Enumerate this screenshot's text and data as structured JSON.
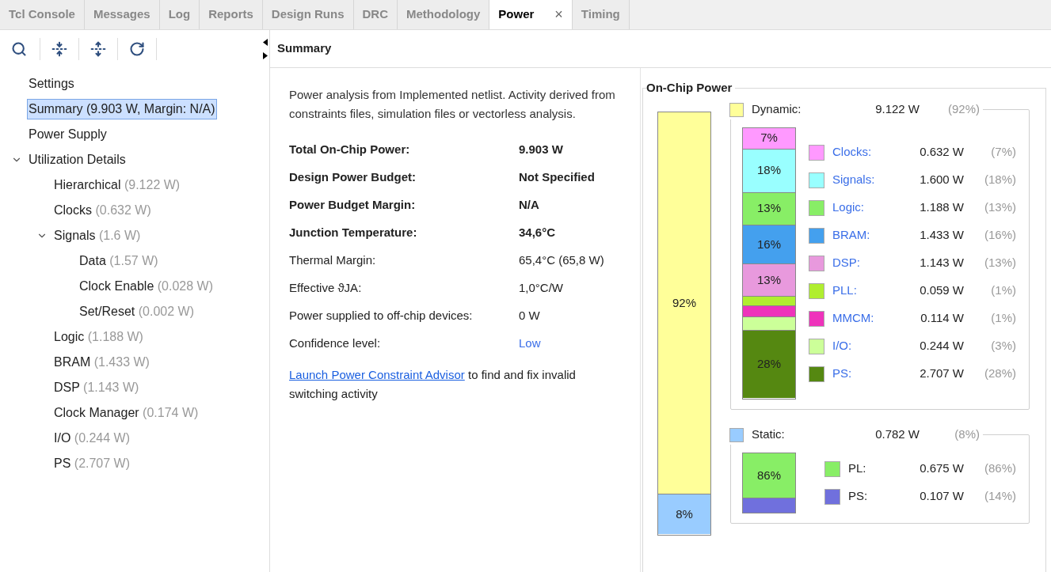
{
  "tabs": [
    {
      "label": "Tcl Console",
      "selected": false
    },
    {
      "label": "Messages",
      "selected": false
    },
    {
      "label": "Log",
      "selected": false
    },
    {
      "label": "Reports",
      "selected": false
    },
    {
      "label": "Design Runs",
      "selected": false
    },
    {
      "label": "DRC",
      "selected": false
    },
    {
      "label": "Methodology",
      "selected": false
    },
    {
      "label": "Power",
      "selected": true,
      "close": "×"
    },
    {
      "label": "Timing",
      "selected": false
    }
  ],
  "sidebar": {
    "tree": [
      {
        "label": "Settings",
        "selected": false
      },
      {
        "label": "Summary (9.903 W, Margin: N/A)",
        "selected": true
      },
      {
        "label": "Power Supply",
        "selected": false
      },
      {
        "label": "Utilization Details",
        "selected": false,
        "expanded": true,
        "children": [
          {
            "label": "Hierarchical",
            "detail": "(9.122 W)",
            "selected": false
          },
          {
            "label": "Clocks",
            "detail": "(0.632 W)",
            "selected": false
          },
          {
            "label": "Signals",
            "detail": "(1.6 W)",
            "selected": false,
            "expanded": true,
            "children": [
              {
                "label": "Data",
                "detail": "(1.57 W)",
                "selected": false
              },
              {
                "label": "Clock Enable",
                "detail": "(0.028 W)",
                "selected": false
              },
              {
                "label": "Set/Reset",
                "detail": "(0.002 W)",
                "selected": false
              }
            ]
          },
          {
            "label": "Logic",
            "detail": "(1.188 W)",
            "selected": false
          },
          {
            "label": "BRAM",
            "detail": "(1.433 W)",
            "selected": false
          },
          {
            "label": "DSP",
            "detail": "(1.143 W)",
            "selected": false
          },
          {
            "label": "Clock Manager",
            "detail": "(0.174 W)",
            "selected": false
          },
          {
            "label": "I/O",
            "detail": "(0.244 W)",
            "selected": false
          },
          {
            "label": "PS",
            "detail": "(2.707 W)",
            "selected": false
          }
        ]
      }
    ]
  },
  "panel_title": "Summary",
  "summary": {
    "description": "Power analysis from Implemented netlist. Activity derived from constraints files, simulation files or vectorless analysis.",
    "rows": [
      {
        "label": "Total On-Chip Power:",
        "value": "9.903 W",
        "bold": true,
        "link": false
      },
      {
        "label": "Design Power Budget:",
        "value": "Not Specified",
        "bold": true,
        "link": false
      },
      {
        "label": "Power Budget Margin:",
        "value": "N/A",
        "bold": true,
        "link": false
      },
      {
        "label": "Junction Temperature:",
        "value": "34,6°C",
        "bold": true,
        "link": false
      },
      {
        "label": "Thermal Margin:",
        "value": "65,4°C (65,8 W)",
        "bold": false,
        "link": false
      },
      {
        "label": "Effective ϑJA:",
        "value": "1,0°C/W",
        "bold": false,
        "link": false
      },
      {
        "label": "Power supplied to off-chip devices:",
        "value": "0 W",
        "bold": false,
        "link": false
      },
      {
        "label": "Confidence level:",
        "value": "Low",
        "bold": false,
        "link": true
      }
    ],
    "advisor": {
      "link": "Launch Power Constraint Advisor",
      "text": "to find and fix invalid switching activity"
    }
  },
  "on_chip_power": {
    "title": "On-Chip Power",
    "total_bar": [
      {
        "label": "92%",
        "level": 0.906,
        "color": "#ffff99"
      },
      {
        "label": "8%",
        "level": 0.094,
        "color": "#99ccff"
      }
    ],
    "groups": [
      {
        "name": "Dynamic:",
        "value": "9.122 W",
        "percent": "(92%)",
        "color": "#ffff99",
        "items": [
          {
            "name": "Clocks:",
            "value": "0.632 W",
            "percent": "(7%)",
            "color": "#ff99ff",
            "bar_label": "7%",
            "link": true
          },
          {
            "name": "Signals:",
            "value": "1.600 W",
            "percent": "(18%)",
            "color": "#99ffff",
            "bar_label": "18%",
            "link": true
          },
          {
            "name": "Logic:",
            "value": "1.188 W",
            "percent": "(13%)",
            "color": "#88ee66",
            "bar_label": "13%",
            "link": true
          },
          {
            "name": "BRAM:",
            "value": "1.433 W",
            "percent": "(16%)",
            "color": "#44a0ee",
            "bar_label": "16%",
            "link": true
          },
          {
            "name": "DSP:",
            "value": "1.143 W",
            "percent": "(13%)",
            "color": "#e899dd",
            "bar_label": "13%",
            "link": true
          },
          {
            "name": "PLL:",
            "value": "0.059 W",
            "percent": "(1%)",
            "color": "#b0ee30",
            "link": true
          },
          {
            "name": "MMCM:",
            "value": "0.114 W",
            "percent": "(1%)",
            "color": "#ee33bb",
            "link": true
          },
          {
            "name": "I/O:",
            "value": "0.244 W",
            "percent": "(3%)",
            "color": "#ccff99",
            "link": true
          },
          {
            "name": "PS:",
            "value": "2.707 W",
            "percent": "(28%)",
            "color": "#558811",
            "bar_label": "28%",
            "link": true
          }
        ]
      },
      {
        "name": "Static:",
        "value": "0.782 W",
        "percent": "(8%)",
        "color": "#99ccff",
        "items": [
          {
            "name": "PL:",
            "value": "0.675 W",
            "percent": "(86%)",
            "color": "#88ee66",
            "bar_label": "86%",
            "link": false
          },
          {
            "name": "PS:",
            "value": "0.107 W",
            "percent": "(14%)",
            "color": "#7070dd",
            "link": false
          }
        ]
      }
    ]
  }
}
